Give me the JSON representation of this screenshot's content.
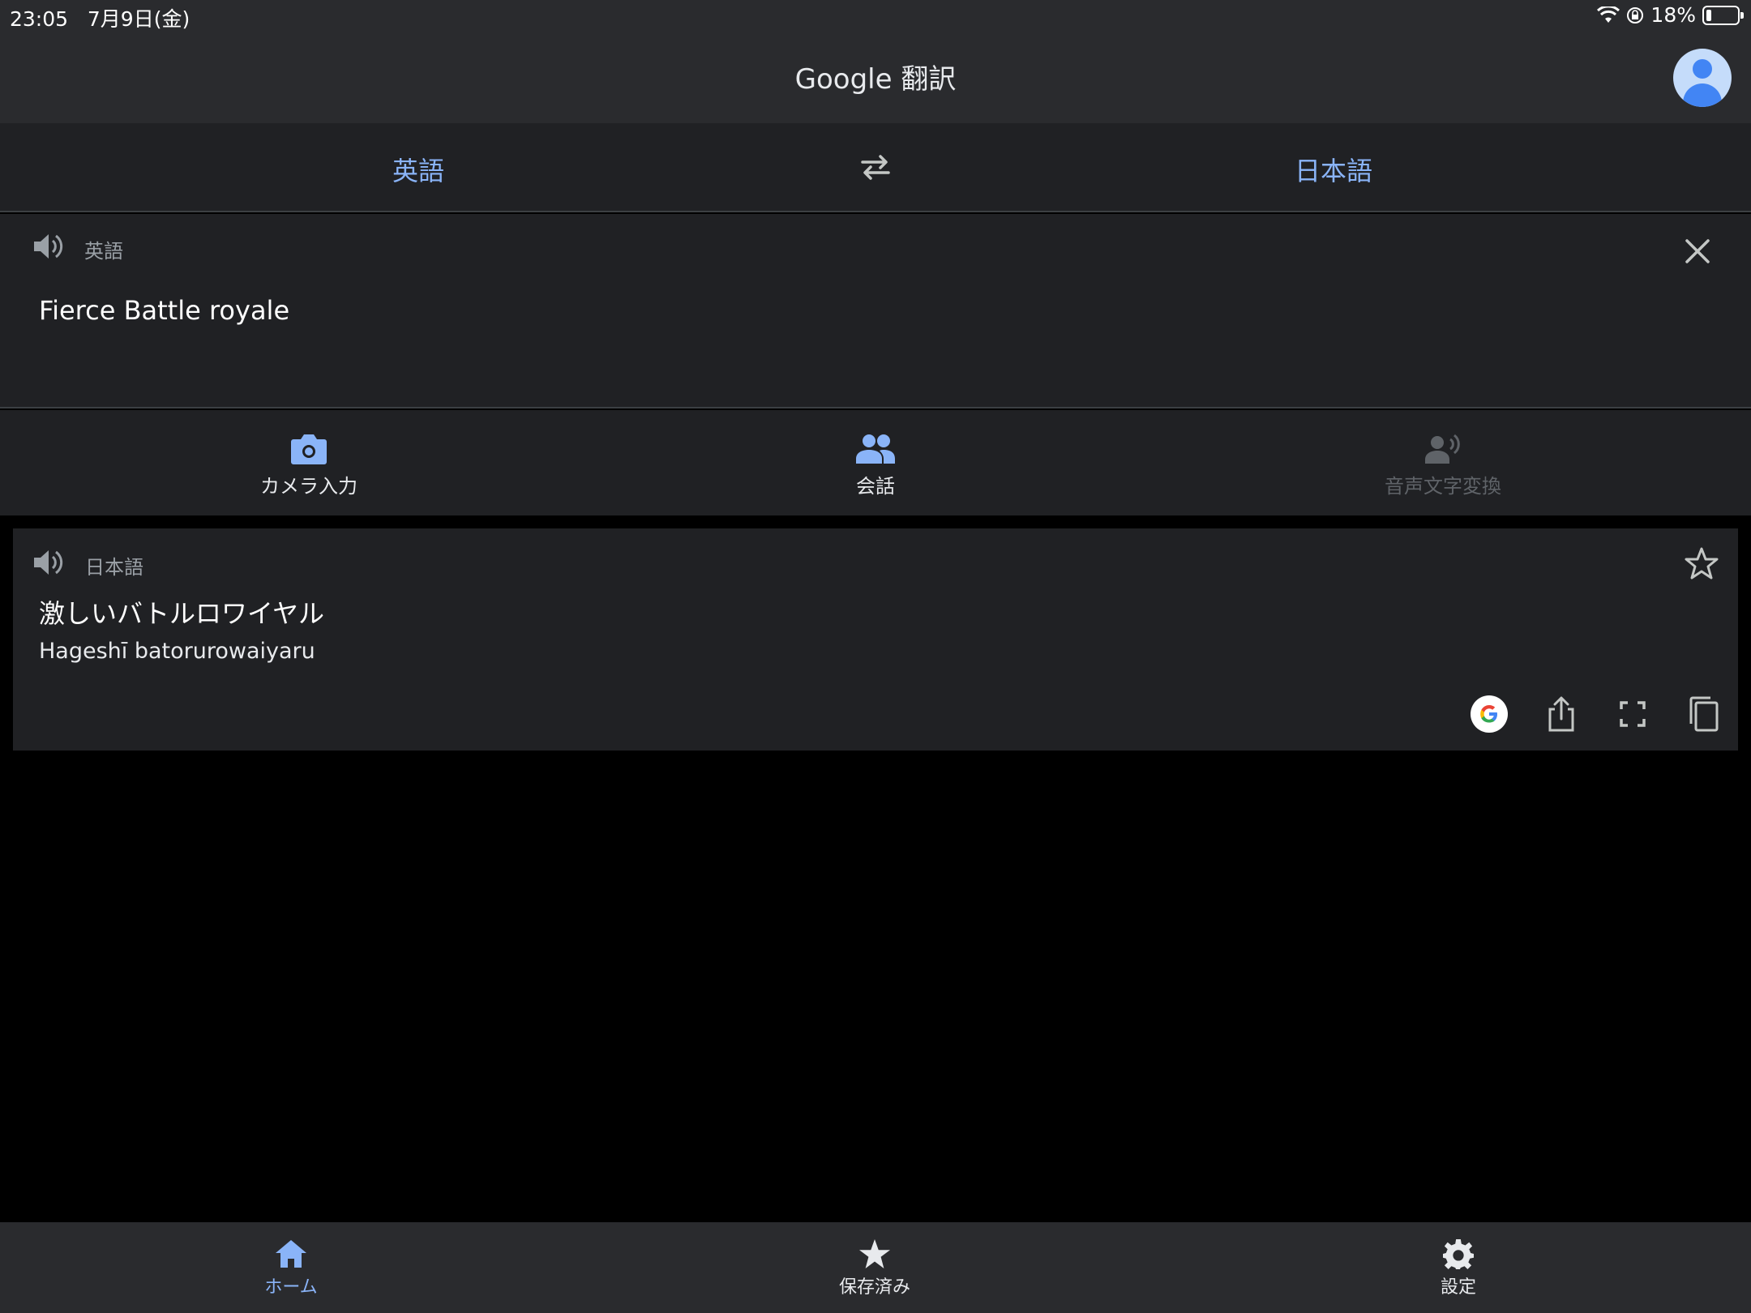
{
  "status_bar": {
    "time": "23:05",
    "date": "7月9日(金)",
    "battery_percent": "18%",
    "icons": [
      "wifi-icon",
      "orientation-lock-icon",
      "battery-icon"
    ]
  },
  "app_bar": {
    "title": "Google 翻訳",
    "avatar_icon": "account-avatar-icon"
  },
  "language_bar": {
    "source_language": "英語",
    "target_language": "日本語",
    "swap_icon": "swap-arrows-icon"
  },
  "input_panel": {
    "language_label": "英語",
    "text": "Fierce Battle royale",
    "icons": [
      "speaker-icon",
      "close-icon"
    ]
  },
  "tools": [
    {
      "label": "カメラ入力",
      "icon": "camera-icon",
      "enabled": true
    },
    {
      "label": "会話",
      "icon": "people-icon",
      "enabled": true
    },
    {
      "label": "音声文字変換",
      "icon": "voice-transcribe-icon",
      "enabled": false
    }
  ],
  "result": {
    "language_label": "日本語",
    "text": "激しいバトルロワイヤル",
    "romanization": "Hageshī batorurowaiyaru",
    "icons": [
      "speaker-icon",
      "star-icon",
      "google-icon",
      "share-icon",
      "fullscreen-icon",
      "copy-icon"
    ]
  },
  "bottom_nav": [
    {
      "label": "ホーム",
      "icon": "home-icon",
      "active": true
    },
    {
      "label": "保存済み",
      "icon": "star-icon",
      "active": false
    },
    {
      "label": "設定",
      "icon": "gear-icon",
      "active": false
    }
  ],
  "colors": {
    "accent": "#8ab4f8",
    "surface": "#202124",
    "bar": "#2a2b2e",
    "background": "#000000"
  }
}
